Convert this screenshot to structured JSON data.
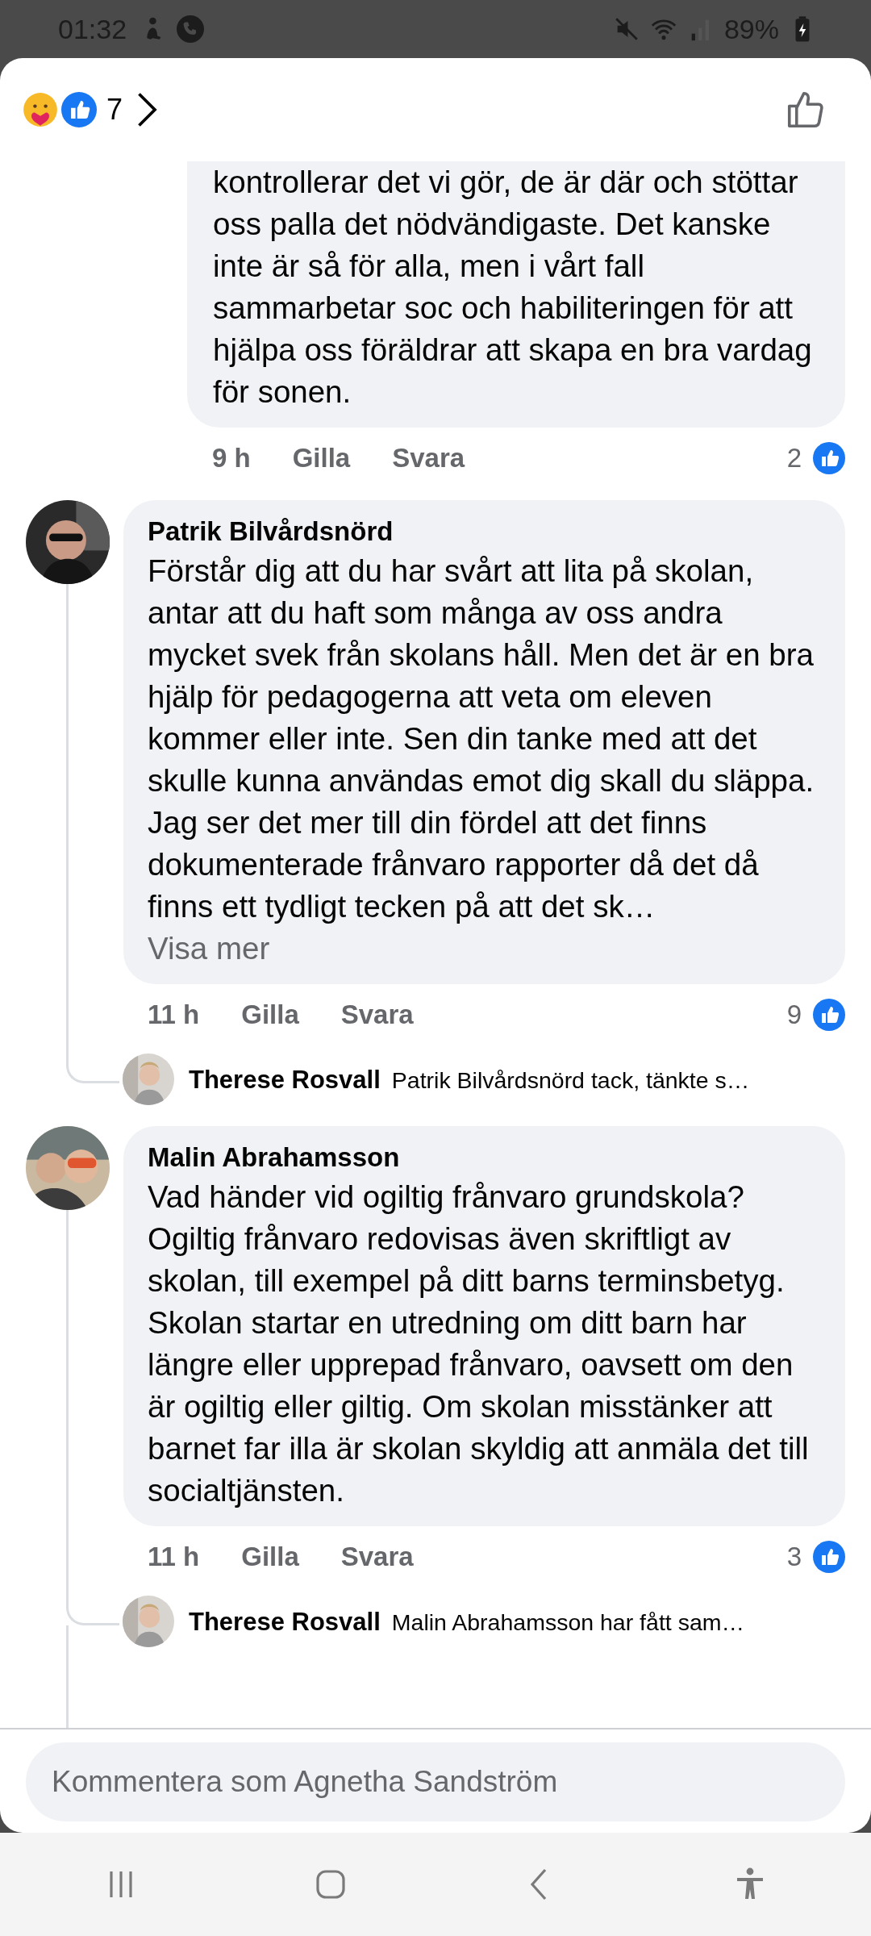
{
  "status_bar": {
    "time": "01:32",
    "battery": "89%"
  },
  "header": {
    "reaction_count": "7"
  },
  "comments": [
    {
      "kind": "continuation",
      "text": "kontrollerar det vi gör, de är där och stöttar oss palla det nödvändigaste. Det kanske inte är så för alla, men i vårt fall sammarbetar soc och habiliteringen för att hjälpa oss föräldrar att skapa en bra vardag för sonen.",
      "time": "9 h",
      "like": "Gilla",
      "reply": "Svara",
      "reactions": "2"
    },
    {
      "kind": "comment",
      "author": "Patrik Bilvårdsnörd",
      "text": "Förstår dig att du har svårt att lita på skolan, antar att du haft som många av oss andra mycket svek från skolans håll. Men det är en bra hjälp för pedagogerna att veta om eleven kommer eller inte. Sen din tanke med att det skulle kunna användas emot dig skall du släppa. Jag ser det mer till din fördel att det finns dokumenterade frånvaro rapporter då det då finns ett tydligt tecken på att det sk…",
      "see_more": "Visa mer",
      "time": "11 h",
      "like": "Gilla",
      "reply": "Svara",
      "reactions": "9",
      "replies": [
        {
          "author": "Therese Rosvall",
          "text": "Patrik Bilvårdsnörd tack, tänkte s…"
        }
      ],
      "more_below": false
    },
    {
      "kind": "comment",
      "author": "Malin Abrahamsson",
      "text": "Vad händer vid ogiltig frånvaro grundskola? Ogiltig frånvaro redovisas även skriftligt av skolan, till exempel på ditt barns terminsbetyg. Skolan startar en utredning om ditt barn har längre eller upprepad frånvaro, oavsett om den är ogiltig eller giltig. Om skolan misstänker att barnet far illa är skolan skyldig att anmäla det till socialtjänsten.",
      "time": "11 h",
      "like": "Gilla",
      "reply": "Svara",
      "reactions": "3",
      "replies": [
        {
          "author": "Therese Rosvall",
          "text": "Malin Abrahamsson har fått sam…"
        }
      ],
      "more_below": true
    }
  ],
  "composer": {
    "placeholder": "Kommentera som Agnetha Sandström"
  }
}
